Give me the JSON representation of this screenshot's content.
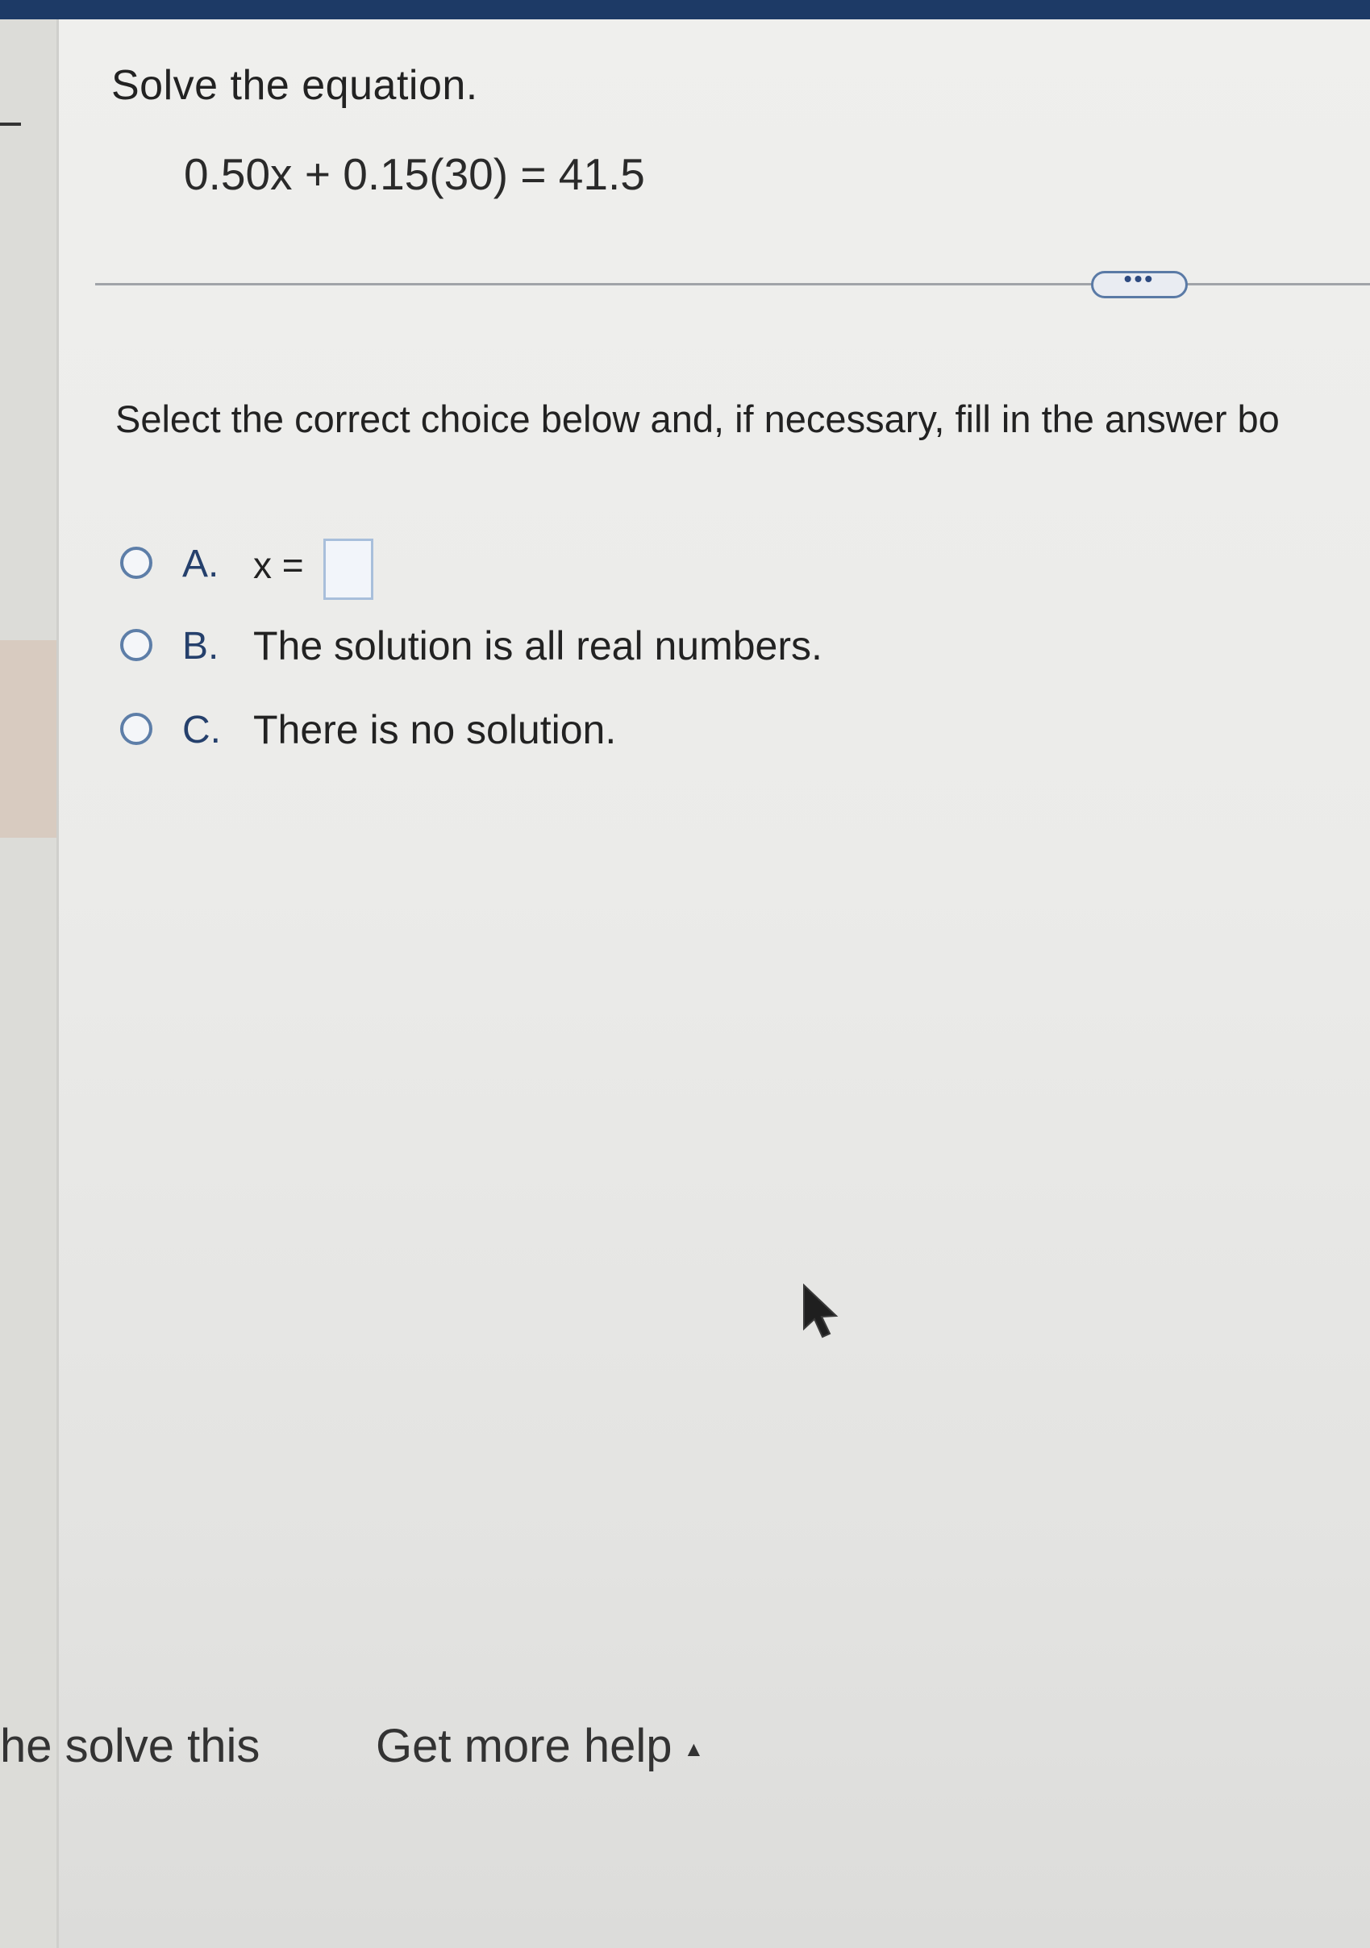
{
  "question": {
    "title": "Solve the equation.",
    "equation": "0.50x + 0.15(30) = 41.5"
  },
  "expand_button": {
    "label": "•••"
  },
  "instruction": "Select the correct choice below and, if necessary, fill in the answer bo",
  "choices": [
    {
      "letter": "A.",
      "text": "x =",
      "answer_value": ""
    },
    {
      "letter": "B.",
      "text": "The solution is all real numbers."
    },
    {
      "letter": "C.",
      "text": "There is no solution."
    }
  ],
  "footer": {
    "left_label": "he solve this",
    "help_label": "Get more help",
    "help_caret": "▲"
  },
  "colors": {
    "accent": "#5d7ea8",
    "top_bar": "#1d3a66"
  }
}
